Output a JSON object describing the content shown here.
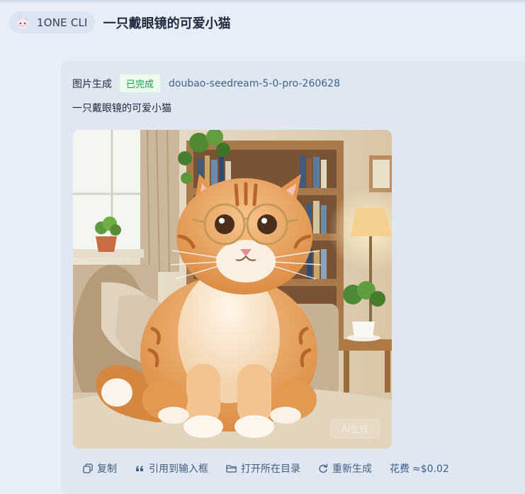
{
  "header": {
    "app_name": "1ONE CLI",
    "chat_title": "一只戴眼镜的可爱小猫"
  },
  "message": {
    "type_label": "图片生成",
    "status": "已完成",
    "model": "doubao-seedream-5-0-pro-260628",
    "prompt": "一只戴眼镜的可爱小猫",
    "image": {
      "watermark": "AI生成",
      "subject": "orange tabby cat wearing round glasses on a sofa"
    },
    "actions": {
      "copy": "复制",
      "quote": "引用到输入框",
      "open_folder": "打开所在目录",
      "regenerate": "重新生成"
    },
    "cost": {
      "label": "花费",
      "value": "≈$0.02"
    }
  },
  "colors": {
    "background": "#e7eef8",
    "card": "#dfe7f3",
    "status_green": "#16a34a",
    "accent_blue": "#3b5a8a"
  },
  "icons": [
    "cat-avatar-icon",
    "copy-icon",
    "quote-icon",
    "folder-icon",
    "refresh-icon"
  ]
}
